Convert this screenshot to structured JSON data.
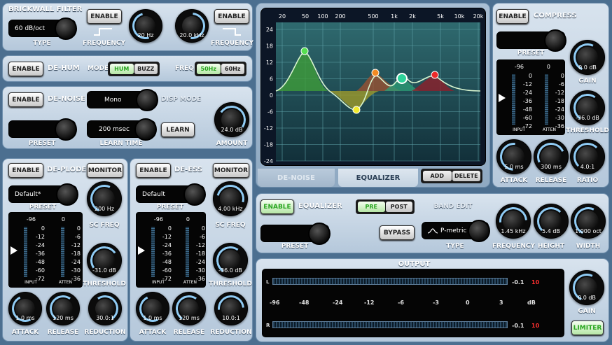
{
  "brickwall": {
    "title": "BRICKWALL FILTER",
    "enable": "ENABLE",
    "type_value": "60 dB/oct",
    "type_label": "TYPE",
    "freq_label": "FREQUENCY",
    "low_value": "20 Hz",
    "high_value": "20.0 kHz"
  },
  "dehum": {
    "enable": "ENABLE",
    "title": "DE-HUM",
    "mode_label": "MODE",
    "mode_options": [
      "HUM",
      "BUZZ"
    ],
    "freq_label": "FREQ",
    "freq_options": [
      "50Hz",
      "60Hz"
    ]
  },
  "denoise": {
    "enable": "ENABLE",
    "title": "DE-NOISE",
    "mode_value": "Mono",
    "disp_mode": "DISP MODE",
    "preset_label": "PRESET",
    "learn_time_value": "200 msec",
    "learn_time_label": "LEARN TIME",
    "learn": "LEARN",
    "amount_value": "24.0 dB",
    "amount_label": "AMOUNT"
  },
  "deplode": {
    "enable": "ENABLE",
    "title": "DE-PLODE",
    "monitor": "MONITOR",
    "preset_value": "Default*",
    "preset_label": "PRESET",
    "sc_freq_value": "200 Hz",
    "sc_freq_label": "SC FREQ",
    "threshold_value": "-31.0 dB",
    "threshold_label": "THRESHOLD",
    "attack_value": "1.0 ms",
    "attack_label": "ATTACK",
    "release_value": "120 ms",
    "release_label": "RELEASE",
    "reduction_value": "30.0:1",
    "reduction_label": "REDUCTION",
    "input_label": "INPUT",
    "atten_label": "ATTEN"
  },
  "deess": {
    "enable": "ENABLE",
    "title": "DE-ESS",
    "monitor": "MONITOR",
    "preset_value": "Default",
    "preset_label": "PRESET",
    "sc_freq_value": "4.00 kHz",
    "sc_freq_label": "SC FREQ",
    "threshold_value": "-36.0 dB",
    "threshold_label": "THRESHOLD",
    "attack_value": "1.0 ms",
    "attack_label": "ATTACK",
    "release_value": "120 ms",
    "release_label": "RELEASE",
    "reduction_value": "10.0:1",
    "reduction_label": "REDUCTION",
    "input_label": "INPUT",
    "atten_label": "ATTEN"
  },
  "meter_scale": {
    "input_top": "-96",
    "atten_top": "0",
    "input": [
      "0",
      "-12",
      "-24",
      "-36",
      "-48",
      "-60",
      "-72"
    ],
    "atten": [
      "0",
      "-6",
      "-12",
      "-18",
      "-24",
      "-30",
      "-36"
    ]
  },
  "graph": {
    "freq_ticks": [
      "20",
      "50",
      "100",
      "200",
      "500",
      "1k",
      "2k",
      "5k",
      "10k",
      "20k"
    ],
    "db_ticks": [
      "24",
      "18",
      "12",
      "6",
      "0",
      "-6",
      "-12",
      "-18",
      "-24"
    ],
    "tabs": [
      "DE-NOISE",
      "EQUALIZER"
    ],
    "active_tab": "EQUALIZER",
    "add": "ADD",
    "delete": "DELETE"
  },
  "compress": {
    "enable": "ENABLE",
    "title": "COMPRESS",
    "preset_label": "PRESET",
    "gain_value": "0.0 dB",
    "gain_label": "GAIN",
    "threshold_value": "-36.0 dB",
    "threshold_label": "THRESHOLD",
    "attack_value": "5.0 ms",
    "attack_label": "ATTACK",
    "release_value": "300 ms",
    "release_label": "RELEASE",
    "ratio_value": "4.0:1",
    "ratio_label": "RATIO",
    "input_label": "INPUT",
    "atten_label": "ATTEN"
  },
  "equalizer": {
    "enable": "ENABLE",
    "title": "EQUALIZER",
    "pre_post": [
      "PRE",
      "POST"
    ],
    "preset_label": "PRESET",
    "bypass": "BYPASS",
    "band_edit": "BAND EDIT",
    "type_value": "P-metric",
    "type_label": "TYPE",
    "frequency_value": "1.45 kHz",
    "frequency_label": "FREQUENCY",
    "height_value": "5.4 dB",
    "height_label": "HEIGHT",
    "width_value": "1.000 oct",
    "width_label": "WIDTH"
  },
  "output": {
    "title": "OUTPUT",
    "left": "L",
    "right": "R",
    "scale": [
      "-96",
      "-48",
      "-24",
      "-12",
      "-6",
      "-3",
      "0",
      "3"
    ],
    "db": "dB",
    "l_rms": "-0.1",
    "l_peak": "10",
    "r_rms": "-0.1",
    "r_peak": "10",
    "gain_value": "0.0 dB",
    "gain_label": "GAIN",
    "limiter": "LIMITER"
  },
  "colors": {
    "accent": "#8fcbf4",
    "active_green": "#27a51e",
    "peak_red": "#ff3030"
  }
}
